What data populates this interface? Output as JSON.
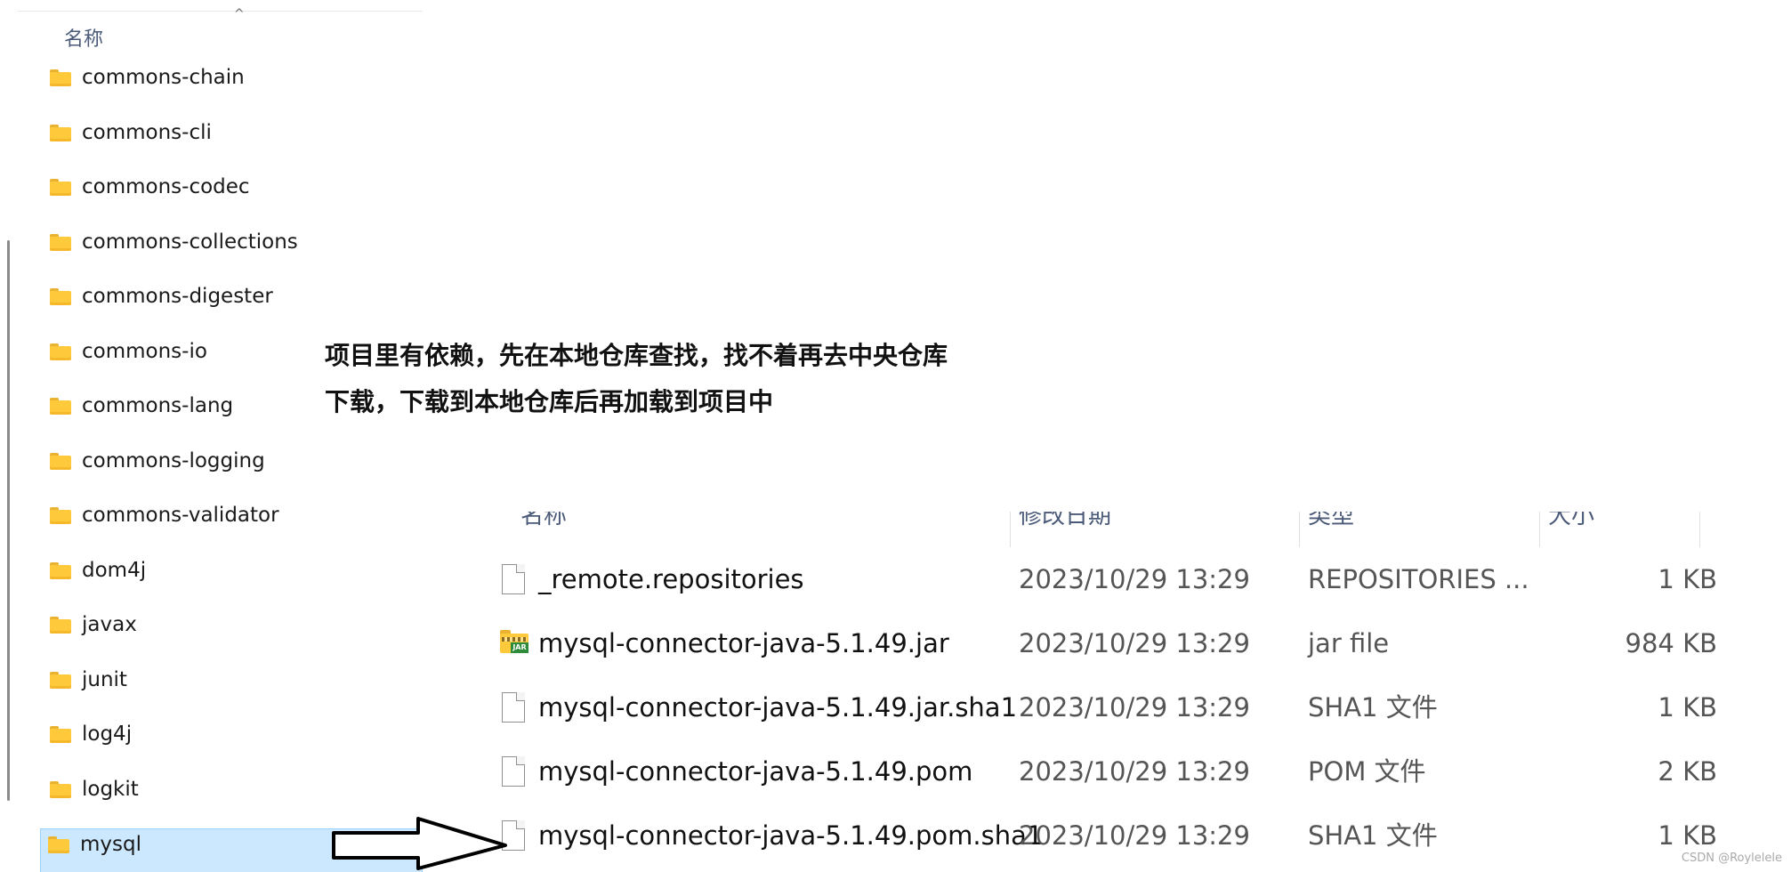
{
  "left_panel": {
    "column_header": "名称",
    "sort_indicator": "^",
    "folders": [
      {
        "label": "commons-chain",
        "selected": false
      },
      {
        "label": "commons-cli",
        "selected": false
      },
      {
        "label": "commons-codec",
        "selected": false
      },
      {
        "label": "commons-collections",
        "selected": false
      },
      {
        "label": "commons-digester",
        "selected": false
      },
      {
        "label": "commons-io",
        "selected": false
      },
      {
        "label": "commons-lang",
        "selected": false
      },
      {
        "label": "commons-logging",
        "selected": false
      },
      {
        "label": "commons-validator",
        "selected": false
      },
      {
        "label": "dom4j",
        "selected": false
      },
      {
        "label": "javax",
        "selected": false
      },
      {
        "label": "junit",
        "selected": false
      },
      {
        "label": "log4j",
        "selected": false
      },
      {
        "label": "logkit",
        "selected": false
      },
      {
        "label": "mysql",
        "selected": true
      }
    ]
  },
  "annotation": {
    "line1": "项目里有依赖，先在本地仓库查找，找不着再去中央仓库",
    "line2": "下载，下载到本地仓库后再加载到项目中"
  },
  "right_panel": {
    "columns": {
      "name": "名称",
      "date": "修改日期",
      "type": "类型",
      "size": "大小"
    },
    "files": [
      {
        "name": "_remote.repositories",
        "date": "2023/10/29 13:29",
        "type": "REPOSITORIES ...",
        "size": "1 KB",
        "icon": "file-icon"
      },
      {
        "name": "mysql-connector-java-5.1.49.jar",
        "date": "2023/10/29 13:29",
        "type": "jar file",
        "size": "984 KB",
        "icon": "jar-icon"
      },
      {
        "name": "mysql-connector-java-5.1.49.jar.sha1",
        "date": "2023/10/29 13:29",
        "type": "SHA1 文件",
        "size": "1 KB",
        "icon": "file-icon"
      },
      {
        "name": "mysql-connector-java-5.1.49.pom",
        "date": "2023/10/29 13:29",
        "type": "POM 文件",
        "size": "2 KB",
        "icon": "file-icon"
      },
      {
        "name": "mysql-connector-java-5.1.49.pom.sha1",
        "date": "2023/10/29 13:29",
        "type": "SHA1 文件",
        "size": "1 KB",
        "icon": "file-icon"
      }
    ],
    "jar_badge": "JAR"
  },
  "watermark": "CSDN @Roylelele",
  "colors": {
    "selection_bg": "#cce8ff",
    "selection_border": "#99d1ff",
    "folder_yellow": "#ffc93c",
    "header_text": "#4a5a78"
  }
}
